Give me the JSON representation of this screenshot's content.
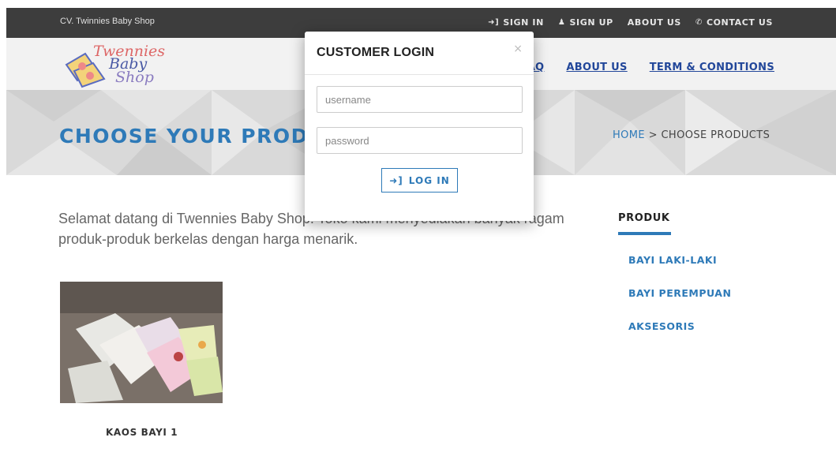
{
  "topbar": {
    "brand": "CV. Twinnies Baby Shop",
    "links": [
      {
        "label": "SIGN IN",
        "icon": "sign-in-icon"
      },
      {
        "label": "SIGN UP",
        "icon": "user-icon"
      },
      {
        "label": "ABOUT US",
        "icon": ""
      },
      {
        "label": "CONTACT US",
        "icon": "phone-icon"
      }
    ]
  },
  "logo": {
    "line1": "Twennies",
    "line2": "Baby",
    "line3": "Shop"
  },
  "nav": {
    "items": [
      "FAQ",
      "ABOUT US",
      "TERM & CONDITIONS"
    ]
  },
  "banner": {
    "title": "CHOOSE YOUR PRODUCTS",
    "breadcrumb_home": "HOME",
    "breadcrumb_sep": ">",
    "breadcrumb_current": "CHOOSE PRODUCTS"
  },
  "main": {
    "intro": "Selamat datang di Twennies Baby Shop. Toko kami menyediakan banyak ragam produk-produk berkelas dengan harga menarik.",
    "products": [
      {
        "name": "KAOS BAYI 1"
      }
    ]
  },
  "sidebar": {
    "heading": "PRODUK",
    "categories": [
      "BAYI LAKI-LAKI",
      "BAYI PEREMPUAN",
      "AKSESORIS"
    ]
  },
  "modal": {
    "title": "CUSTOMER LOGIN",
    "close": "×",
    "username_placeholder": "username",
    "password_placeholder": "password",
    "login_label": "LOG IN"
  },
  "colors": {
    "accent": "#2e7ab8",
    "topbar": "#3d3d3d",
    "nav": "#22479a"
  }
}
